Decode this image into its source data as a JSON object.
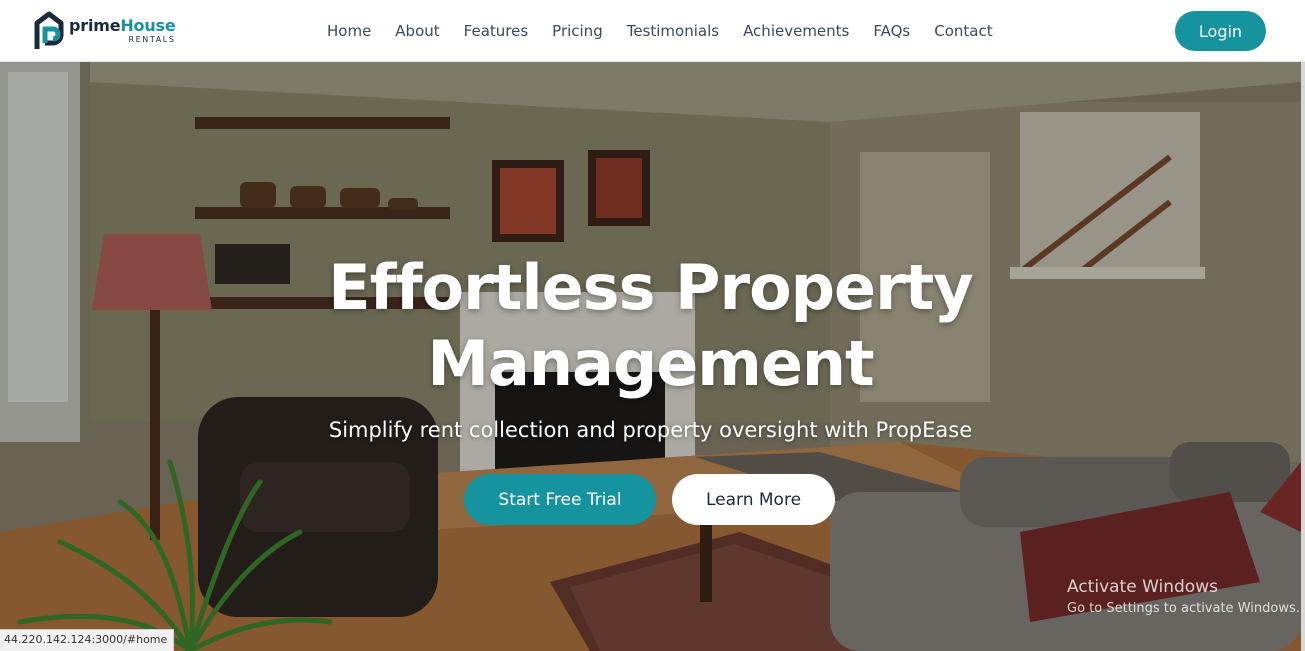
{
  "brand": {
    "name_part1": "prime",
    "name_part2": "House",
    "tagline": "RENTALS",
    "accent_color": "#15939f",
    "dark_color": "#1b2a3a"
  },
  "nav": {
    "items": [
      {
        "label": "Home"
      },
      {
        "label": "About"
      },
      {
        "label": "Features"
      },
      {
        "label": "Pricing"
      },
      {
        "label": "Testimonials"
      },
      {
        "label": "Achievements"
      },
      {
        "label": "FAQs"
      },
      {
        "label": "Contact"
      }
    ],
    "login_label": "Login"
  },
  "hero": {
    "title_line1": "Effortless Property",
    "title_line2": "Management",
    "subtitle": "Simplify rent collection and property oversight with PropEase",
    "primary_cta": "Start Free Trial",
    "secondary_cta": "Learn More",
    "background": "living-room-photo"
  },
  "os_overlay": {
    "activate_title": "Activate Windows",
    "activate_subtitle": "Go to Settings to activate Windows."
  },
  "status_bar": {
    "url": "44.220.142.124:3000/#home"
  }
}
